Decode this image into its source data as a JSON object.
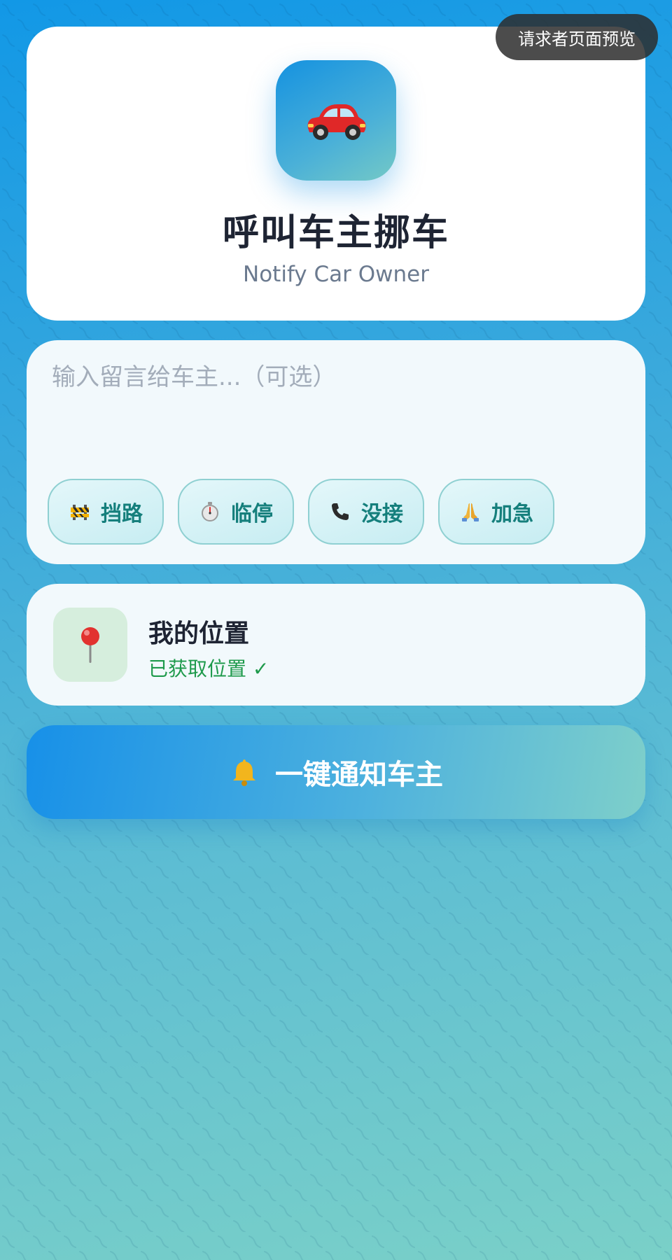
{
  "preview_label": "请求者页面预览",
  "header": {
    "app_icon": "car-icon",
    "title": "呼叫车主挪车",
    "subtitle": "Notify Car Owner"
  },
  "message": {
    "placeholder": "输入留言给车主...（可选）",
    "value": "",
    "chips": [
      {
        "icon": "construction-barrier-icon",
        "label": "挡路"
      },
      {
        "icon": "stopwatch-icon",
        "label": "临停"
      },
      {
        "icon": "phone-icon",
        "label": "没接"
      },
      {
        "icon": "praying-hands-icon",
        "label": "加急"
      }
    ]
  },
  "location": {
    "icon": "location-pin-icon",
    "title": "我的位置",
    "status": "已获取位置 ✓"
  },
  "notify_button": {
    "icon": "bell-icon",
    "label": "一键通知车主"
  },
  "colors": {
    "accent": "#1592e0",
    "chip_text": "#157f7c",
    "success": "#1e9a4b",
    "title": "#1e2433"
  }
}
